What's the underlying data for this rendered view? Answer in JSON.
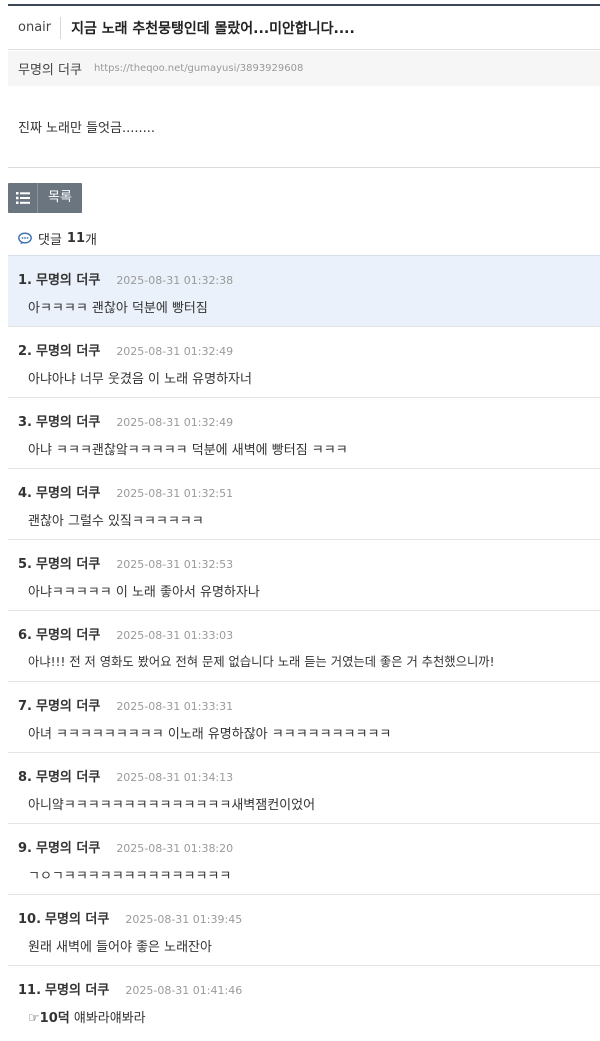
{
  "header": {
    "board": "onair",
    "title": "지금 노래 추천뭉탱인데 몰랐어...미안합니다...."
  },
  "meta": {
    "author": "무명의 더쿠",
    "url": "https://theqoo.net/gumayusi/3893929608"
  },
  "post": {
    "body": "진짜 노래만 들엇금........"
  },
  "toolbar": {
    "list_label": "목록",
    "list_icon": "list-icon"
  },
  "comments_header": {
    "label": "댓글",
    "count": "11",
    "unit": "개",
    "icon": "speech-bubble-icon"
  },
  "comments": [
    {
      "num": "1.",
      "author": "무명의 더쿠",
      "date": "2025-08-31 01:32:38",
      "text": "아ㅋㅋㅋㅋ 괜찮아 덕분에 빵터짐",
      "highlight": true
    },
    {
      "num": "2.",
      "author": "무명의 더쿠",
      "date": "2025-08-31 01:32:49",
      "text": "아냐아냐 너무 웃겼음 이 노래 유명하자너"
    },
    {
      "num": "3.",
      "author": "무명의 더쿠",
      "date": "2025-08-31 01:32:49",
      "text": "아냐 ㅋㅋㅋ괜찮앜ㅋㅋㅋㅋㅋ 덕분에 새벽에 빵터짐 ㅋㅋㅋ"
    },
    {
      "num": "4.",
      "author": "무명의 더쿠",
      "date": "2025-08-31 01:32:51",
      "text": "괜찮아 그럴수 있짘ㅋㅋㅋㅋㅋㅋ"
    },
    {
      "num": "5.",
      "author": "무명의 더쿠",
      "date": "2025-08-31 01:32:53",
      "text": "아냐ㅋㅋㅋㅋㅋ 이 노래 좋아서 유명하자나"
    },
    {
      "num": "6.",
      "author": "무명의 더쿠",
      "date": "2025-08-31 01:33:03",
      "text": "아냐!!! 전 저 영화도 봤어요 전혀 문제 없습니다 노래 듣는 거였는데 좋은 거 추천했으니까!"
    },
    {
      "num": "7.",
      "author": "무명의 더쿠",
      "date": "2025-08-31 01:33:31",
      "text": "아녀 ㅋㅋㅋㅋㅋㅋㅋㅋㅋ 이노래 유명하잖아 ㅋㅋㅋㅋㅋㅋㅋㅋㅋㅋ"
    },
    {
      "num": "8.",
      "author": "무명의 더쿠",
      "date": "2025-08-31 01:34:13",
      "text": "아니얔ㅋㅋㅋㅋㅋㅋㅋㅋㅋㅋㅋㅋㅋㅋ새벽잼컨이었어"
    },
    {
      "num": "9.",
      "author": "무명의 더쿠",
      "date": "2025-08-31 01:38:20",
      "text": "ㄱㅇㄱㅋㅋㅋㅋㅋㅋㅋㅋㅋㅋㅋㅋㅋㅋ"
    },
    {
      "num": "10.",
      "author": "무명의 더쿠",
      "date": "2025-08-31 01:39:45",
      "text": "원래 새벽에 들어야 좋은 노래잔아"
    },
    {
      "num": "11.",
      "author": "무명의 더쿠",
      "date": "2025-08-31 01:41:46",
      "text_prefix": "☞10덕",
      "text": "얘봐라얘봐라"
    }
  ]
}
